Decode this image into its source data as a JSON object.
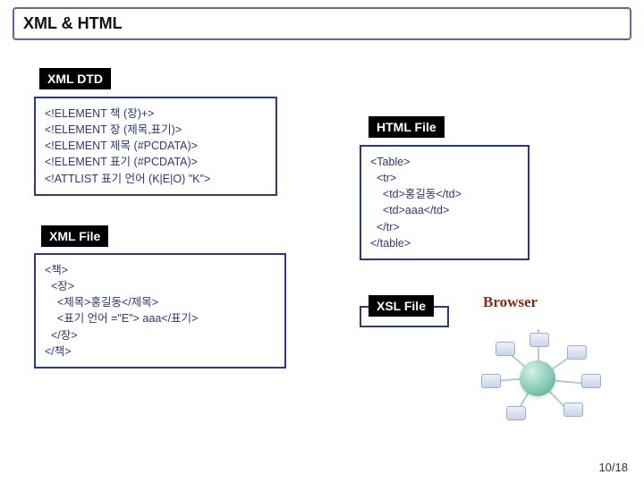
{
  "header": {
    "title": "XML & HTML"
  },
  "dtd": {
    "tab": "XML DTD",
    "content": "<!ELEMENT 책 (장)+>\n<!ELEMENT 장 (제목,표기)>\n<!ELEMENT 제목 (#PCDATA)>\n<!ELEMENT 표기 (#PCDATA)>\n<!ATTLIST 표기 언어 (K|E|O) \"K\">"
  },
  "xmlfile": {
    "tab": "XML File",
    "content": "<책>\n  <장>\n    <제목>홍길동</제목>\n    <표기 언어 =\"E\"> aaa</표기>\n  </장>\n</책>"
  },
  "htmlfile": {
    "tab": "HTML File",
    "content": "<Table>\n  <tr>\n    <td>홍길동</td>\n    <td>aaa</td>\n  </tr>\n</table>"
  },
  "xslfile": {
    "tab": "XSL File"
  },
  "browser": {
    "label": "Browser"
  },
  "pagenum": "10/18"
}
